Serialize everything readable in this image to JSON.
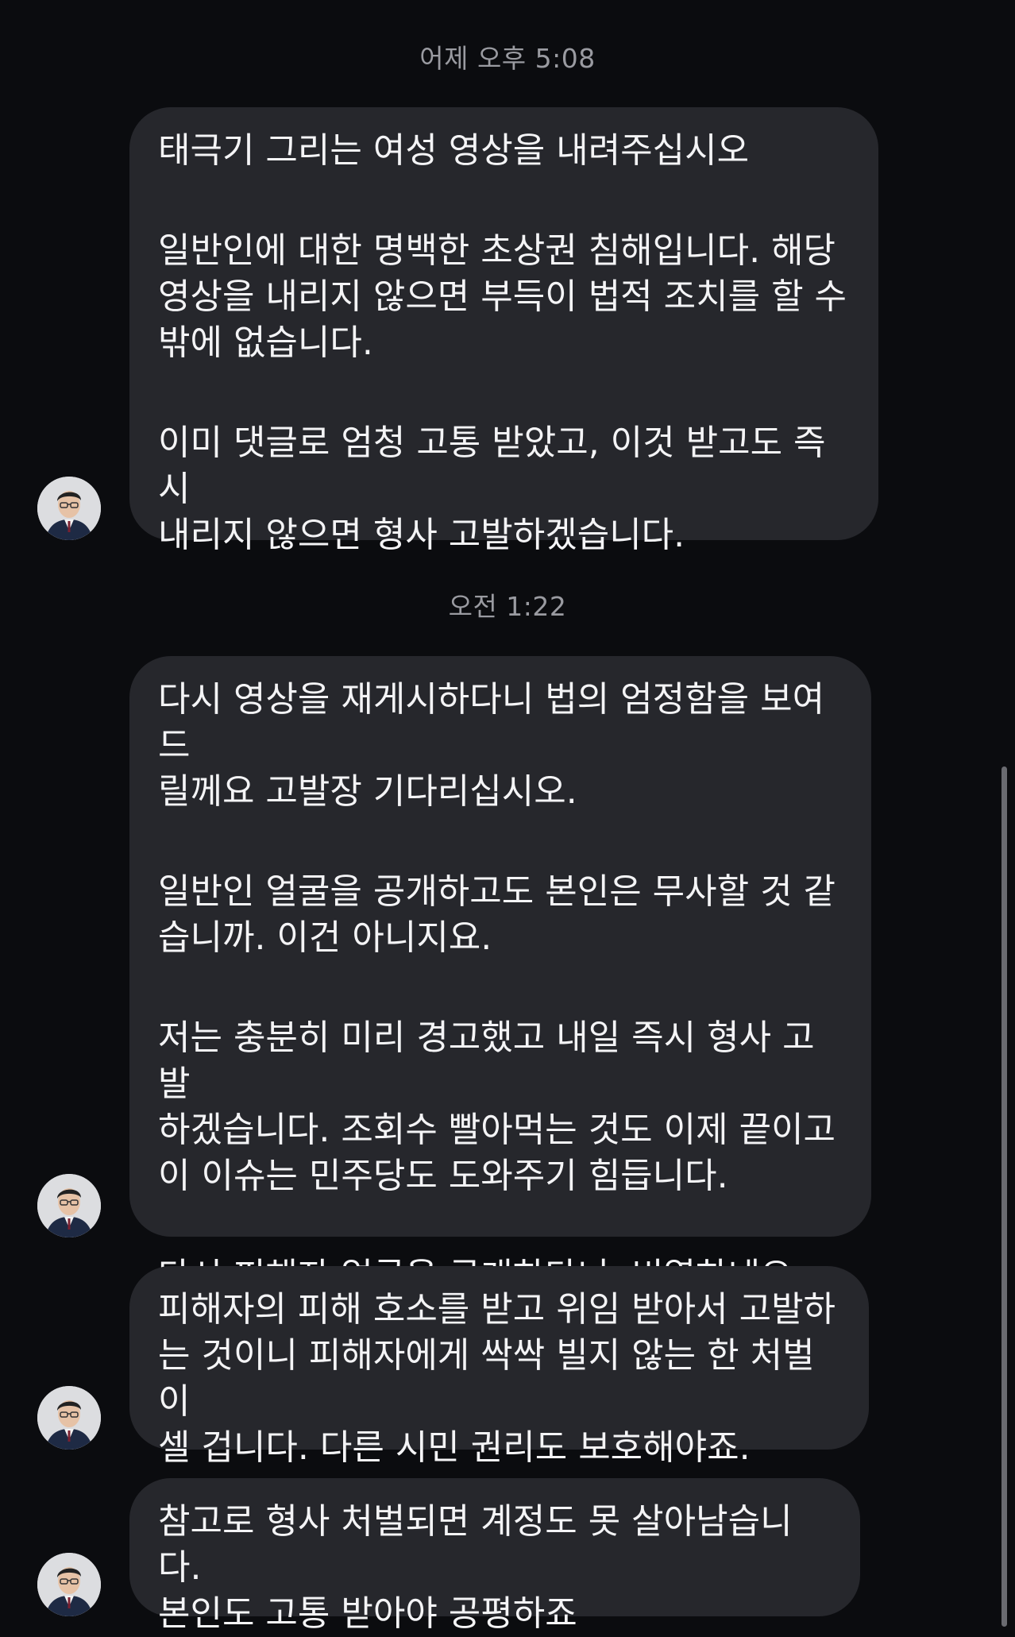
{
  "conversation": {
    "groups": [
      {
        "timestamp": "어제 오후 5:08",
        "messages": [
          {
            "paragraphs": [
              "태극기 그리는 여성 영상을 내려주십시오",
              "일반인에 대한 명백한 초상권 침해입니다. 해당\n영상을 내리지 않으면 부득이 법적 조치를 할 수\n밖에 없습니다.",
              "이미 댓글로 엄청 고통 받았고, 이것 받고도 즉시\n내리지 않으면 형사 고발하겠습니다."
            ]
          }
        ]
      },
      {
        "timestamp": "오전 1:22",
        "messages": [
          {
            "paragraphs": [
              "다시 영상을 재게시하다니 법의 엄정함을 보여드\n릴께요 고발장 기다리십시오.",
              "일반인 얼굴을 공개하고도 본인은 무사할 것 같\n습니까. 이건 아니지요.",
              "저는 충분히 미리 경고했고 내일 즉시 형사 고발\n하겠습니다. 조회수 빨아먹는 것도 이제 끝이고\n이 이슈는 민주당도 도와주기 힘듭니다.",
              "다시 피해자 얼굴을 공개하다니, 비열하네요."
            ]
          },
          {
            "paragraphs": [
              "피해자의 피해 호소를 받고 위임 받아서 고발하\n는 것이니 피해자에게 싹싹 빌지 않는 한 처벌이\n셀 겁니다. 다른 시민 권리도 보호해야죠."
            ]
          },
          {
            "paragraphs": [
              "참고로 형사 처벌되면 계정도 못 살아남습니다.\n본인도 고통 받아야 공평하죠"
            ]
          }
        ]
      }
    ]
  },
  "colors": {
    "background": "#0b0c0f",
    "bubble": "#26272c",
    "text": "#f4f4f6",
    "timestamp": "#9a9ba1"
  },
  "icons": {
    "avatar": "profile-photo-man-glasses-suit"
  }
}
